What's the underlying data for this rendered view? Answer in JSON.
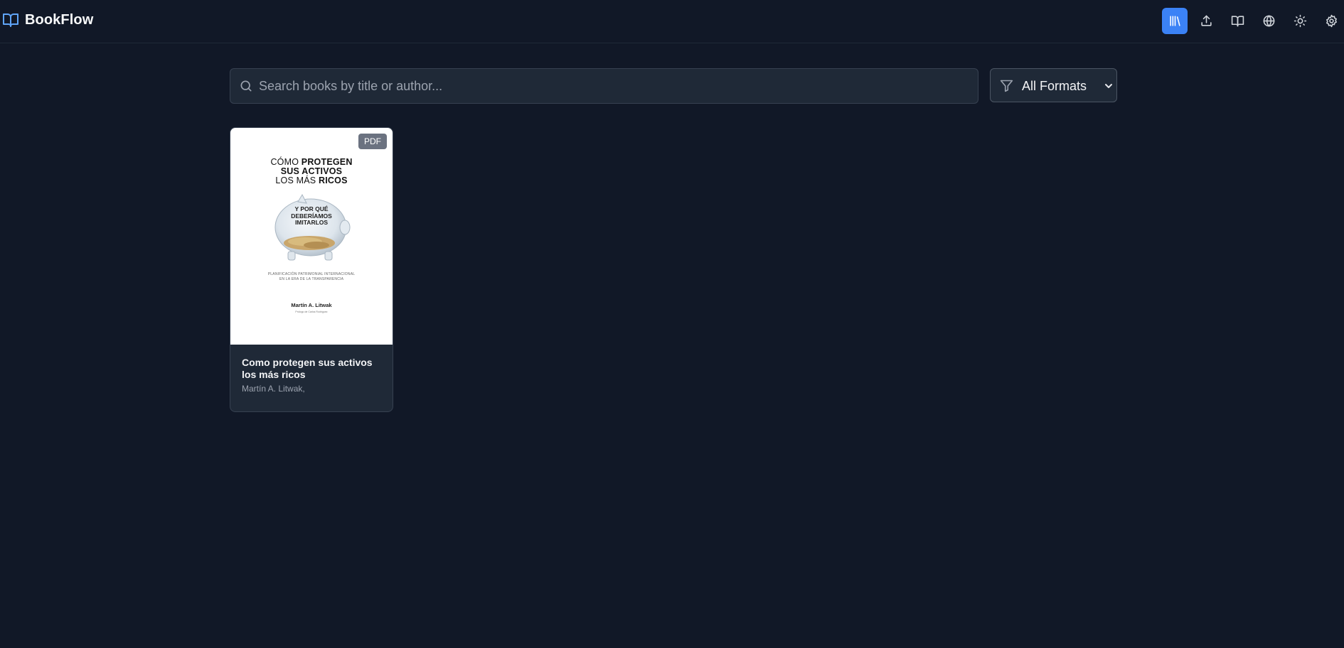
{
  "app": {
    "title": "BookFlow",
    "accent": "#3b82f6"
  },
  "nav": {
    "items": [
      {
        "name": "library",
        "icon": "library-icon",
        "active": true
      },
      {
        "name": "upload",
        "icon": "upload-icon",
        "active": false
      },
      {
        "name": "reader",
        "icon": "open-book-icon",
        "active": false
      },
      {
        "name": "language",
        "icon": "globe-icon",
        "active": false
      },
      {
        "name": "theme",
        "icon": "sun-icon",
        "active": false
      },
      {
        "name": "settings",
        "icon": "gear-icon",
        "active": false
      }
    ]
  },
  "search": {
    "placeholder": "Search books by title or author...",
    "value": ""
  },
  "filter": {
    "selected": "All Formats",
    "icon": "filter-icon"
  },
  "books": [
    {
      "format": "PDF",
      "title": "Como protegen sus activos los más ricos",
      "author": "Martín A. Litwak,",
      "cover": {
        "title_line1_a": "CÓMO ",
        "title_line1_b": "PROTEGEN",
        "title_line2": "SUS ACTIVOS",
        "title_line3_a": "LOS MÁS ",
        "title_line3_b": "RICOS",
        "subtitle_line1": "Y POR QUÉ",
        "subtitle_line2": "DEBERÍAMOS",
        "subtitle_line3": "IMITARLOS",
        "small_line1": "PLANIFICACIÓN PATRIMONIAL INTERNACIONAL",
        "small_line2": "EN LA ERA DE LA TRANSPARENCIA",
        "author": "Martín A. Litwak",
        "author_sub": "Prólogo de Carlos Rodríguez"
      }
    }
  ]
}
